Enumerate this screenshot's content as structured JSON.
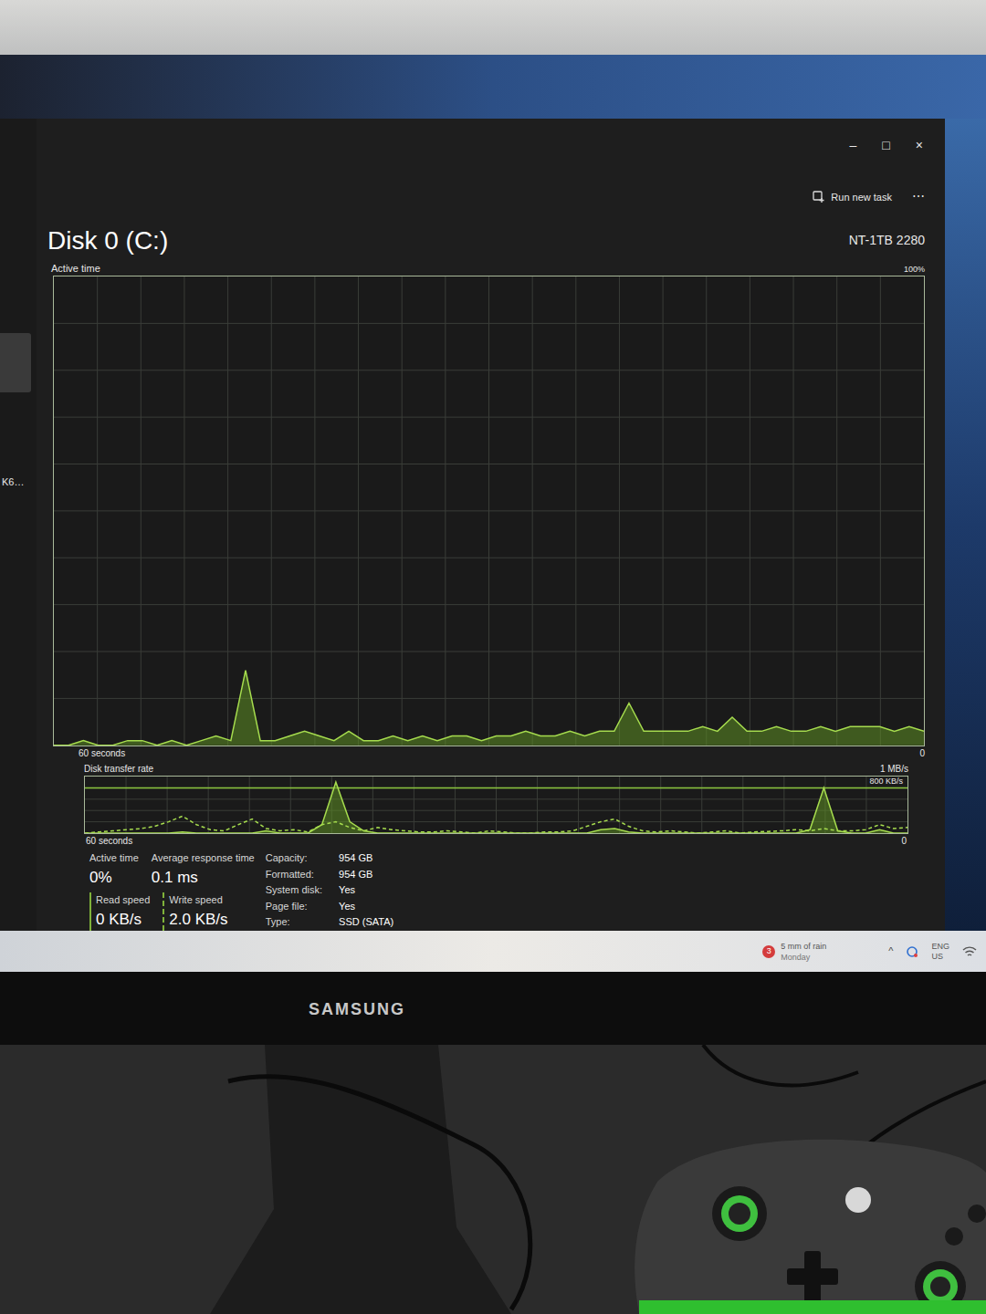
{
  "window": {
    "controls": [
      "–",
      "□",
      "×"
    ]
  },
  "sidebar": {
    "items": [
      {
        "label": "K6…"
      }
    ]
  },
  "toolbar": {
    "run_new_task": "Run new task",
    "more": "⋯"
  },
  "disk": {
    "title": "Disk 0 (C:)",
    "model": "NT-1TB 2280"
  },
  "active_chart": {
    "label": "Active time",
    "max_label": "100%",
    "min_label": "0",
    "time_label": "60 seconds",
    "max": 100,
    "series": [
      {
        "name": "active",
        "kind": "solid",
        "values": [
          0,
          0,
          1,
          0,
          0,
          1,
          1,
          0,
          1,
          0,
          1,
          2,
          1,
          16,
          1,
          1,
          2,
          3,
          2,
          1,
          3,
          1,
          1,
          2,
          1,
          2,
          1,
          2,
          2,
          1,
          2,
          2,
          3,
          2,
          2,
          3,
          2,
          3,
          3,
          9,
          3,
          3,
          3,
          3,
          4,
          3,
          6,
          3,
          3,
          4,
          3,
          3,
          4,
          3,
          4,
          4,
          4,
          3,
          4,
          3
        ]
      }
    ]
  },
  "transfer_chart": {
    "label": "Disk transfer rate",
    "max_label": "1 MB/s",
    "line_label": "800 KB/s",
    "line_value": 800,
    "min_label": "0",
    "time_label": "60 seconds",
    "max": 1000,
    "series": [
      {
        "name": "read",
        "kind": "solid",
        "values": [
          0,
          0,
          0,
          0,
          0,
          0,
          0,
          20,
          0,
          0,
          0,
          0,
          0,
          40,
          0,
          0,
          0,
          150,
          900,
          200,
          40,
          0,
          0,
          0,
          0,
          0,
          0,
          0,
          0,
          0,
          0,
          0,
          0,
          0,
          0,
          0,
          0,
          60,
          80,
          20,
          0,
          0,
          0,
          0,
          0,
          0,
          0,
          0,
          0,
          0,
          0,
          0,
          60,
          800,
          40,
          0,
          0,
          60,
          0,
          0
        ]
      },
      {
        "name": "write",
        "kind": "dashed",
        "values": [
          0,
          20,
          40,
          60,
          80,
          120,
          200,
          300,
          150,
          60,
          40,
          150,
          250,
          80,
          40,
          60,
          20,
          150,
          200,
          100,
          40,
          100,
          60,
          40,
          20,
          20,
          40,
          20,
          0,
          40,
          20,
          0,
          0,
          20,
          20,
          40,
          120,
          200,
          250,
          120,
          40,
          20,
          40,
          20,
          0,
          20,
          40,
          0,
          20,
          30,
          40,
          60,
          40,
          80,
          40,
          40,
          60,
          150,
          80,
          100
        ]
      }
    ]
  },
  "stats": {
    "active_time": {
      "label": "Active time",
      "value": "0%"
    },
    "response_time": {
      "label": "Average response time",
      "value": "0.1 ms"
    },
    "read_speed": {
      "label": "Read speed",
      "value": "0 KB/s"
    },
    "write_speed": {
      "label": "Write speed",
      "value": "2.0 KB/s"
    }
  },
  "properties": [
    {
      "label": "Capacity:",
      "value": "954 GB"
    },
    {
      "label": "Formatted:",
      "value": "954 GB"
    },
    {
      "label": "System disk:",
      "value": "Yes"
    },
    {
      "label": "Page file:",
      "value": "Yes"
    },
    {
      "label": "Type:",
      "value": "SSD (SATA)"
    }
  ],
  "taskbar": {
    "badge": "3",
    "weather": "5 mm of rain",
    "day": "Monday",
    "chevron": "^",
    "lang": "ENG",
    "region": "US"
  },
  "monitor": {
    "brand": "SAMSUNG"
  }
}
